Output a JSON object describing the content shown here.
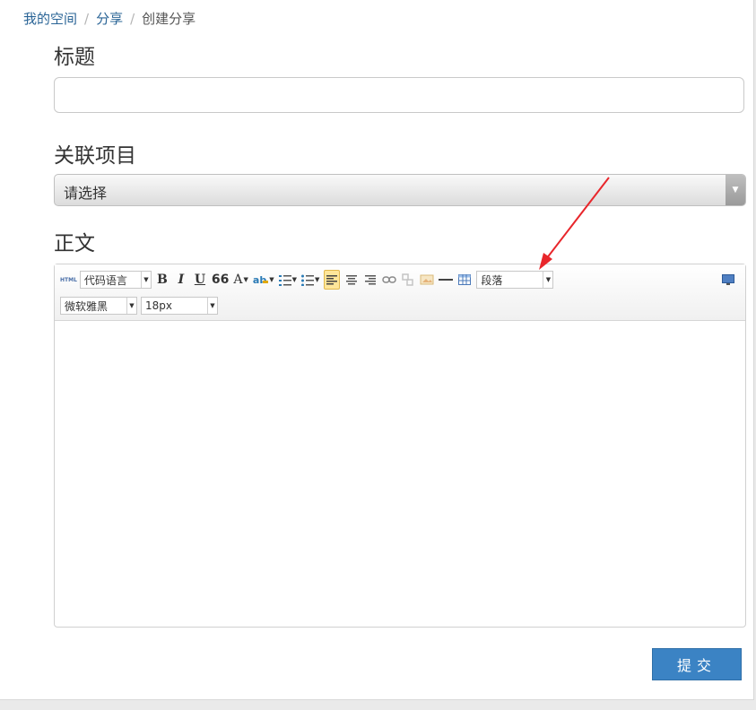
{
  "breadcrumb": {
    "items": [
      "我的空间",
      "分享"
    ],
    "current": "创建分享",
    "separator": "/"
  },
  "form": {
    "title_label": "标题",
    "title_value": "",
    "project_label": "关联项目",
    "project_select_value": "请选择",
    "body_label": "正文"
  },
  "toolbar": {
    "html_label": "HTML",
    "code_lang": "代码语言",
    "bold": "B",
    "italic": "I",
    "underline": "U",
    "quote": "66",
    "font_color": "A",
    "bg_color": "ab",
    "paragraph": "段落",
    "font_family": "微软雅黑",
    "font_size": "18px"
  },
  "submit_label": "提交",
  "colors": {
    "link": "#2a6496",
    "primary_button": "#3b83c4",
    "annotation_arrow": "#e8262b",
    "active_tool": "#ffe69a"
  }
}
